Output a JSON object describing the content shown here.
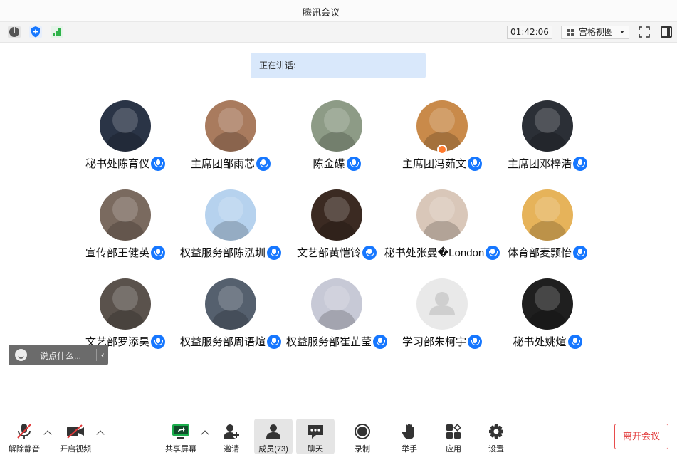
{
  "window": {
    "title": "腾讯会议"
  },
  "toolbar": {
    "timer": "01:42:06",
    "view_mode": "宫格视图",
    "icons": [
      "info-icon",
      "shield-icon",
      "signal-icon",
      "fullscreen-icon",
      "side-panel-icon"
    ]
  },
  "speaking": {
    "label": "正在讲话:"
  },
  "participants": [
    {
      "name": "秘书处陈育仪",
      "avatar_color": "#2a3446"
    },
    {
      "name": "主席团邹雨芯",
      "avatar_color": "#a97b5e"
    },
    {
      "name": "陈金碟",
      "avatar_color": "#8d9b86"
    },
    {
      "name": "主席团冯茹文",
      "avatar_color": "#c98a4a",
      "host": true
    },
    {
      "name": "主席团邓梓浩",
      "avatar_color": "#2b2f36"
    },
    {
      "name": "宣传部王健英",
      "avatar_color": "#7a6a5f"
    },
    {
      "name": "权益服务部陈泓圳",
      "avatar_color": "#b6d2ee"
    },
    {
      "name": "文艺部黄恺铃",
      "avatar_color": "#3b2a22"
    },
    {
      "name": "秘书处张曼�London",
      "avatar_color": "#d9c7b9"
    },
    {
      "name": "体育部麦颢怡",
      "avatar_color": "#e6b35a"
    },
    {
      "name": "文艺部罗添昊",
      "avatar_color": "#5a524c"
    },
    {
      "name": "权益服务部周语煊",
      "avatar_color": "#55606e"
    },
    {
      "name": "权益服务部崔芷莹",
      "avatar_color": "#c7c9d6"
    },
    {
      "name": "学习部朱柯宇",
      "avatar_color": "#e9e9e9",
      "placeholder": true
    },
    {
      "name": "秘书处姚煊",
      "avatar_color": "#1f1f1f"
    }
  ],
  "chat": {
    "placeholder": "说点什么..."
  },
  "bottombar": {
    "unmute": "解除静音",
    "start_video": "开启视频",
    "share_screen": "共享屏幕",
    "invite": "邀请",
    "members": "成员(73)",
    "chat": "聊天",
    "record": "录制",
    "raise_hand": "举手",
    "apps": "应用",
    "settings": "设置",
    "leave": "离开会议"
  },
  "colors": {
    "accent": "#1677ff",
    "leave": "#e23b3b",
    "share": "#1aad4b"
  }
}
